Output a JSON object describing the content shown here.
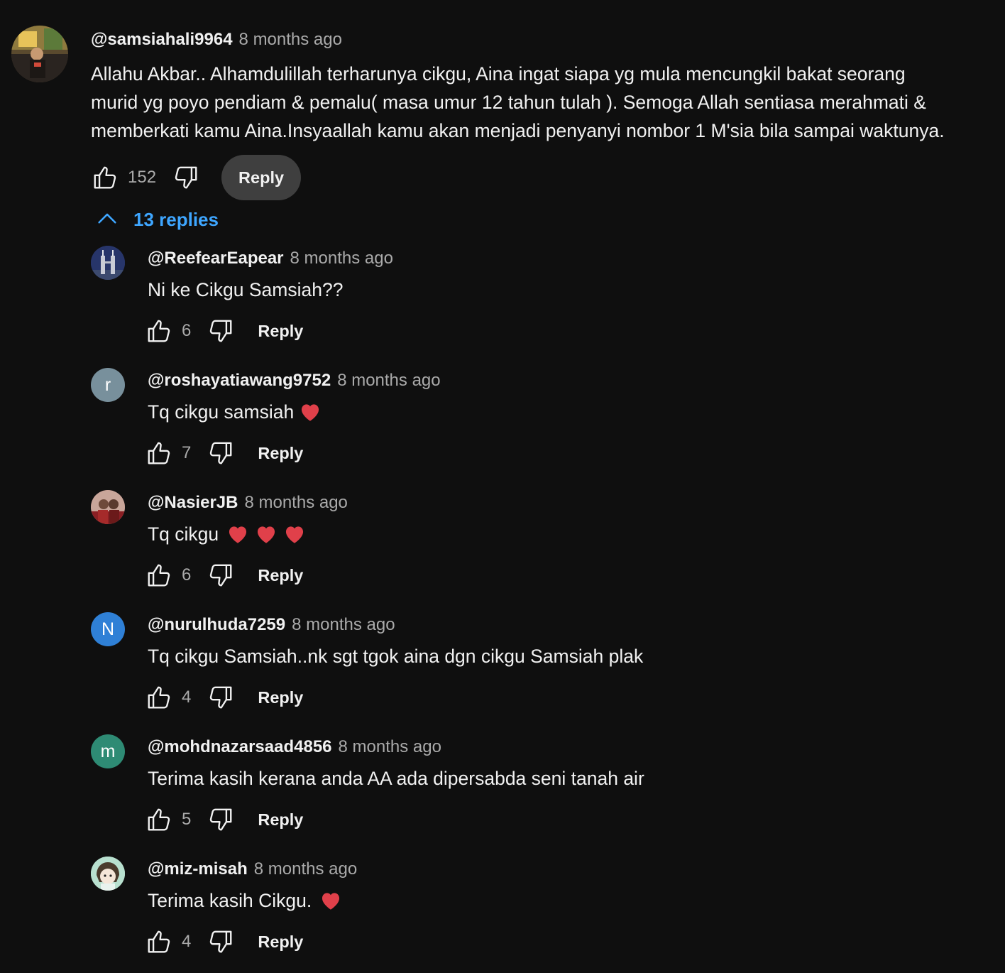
{
  "main_comment": {
    "author": "@samsiahali9964",
    "time": "8 months ago",
    "text_lines": [
      "Allahu Akbar.. Alhamdulillah terharunya cikgu, Aina ingat siapa yg mula mencungkil bakat seorang",
      "murid yg poyo pendiam & pemalu( masa umur 12 tahun tulah ). Semoga Allah sentiasa merahmati &",
      "memberkati kamu Aina.Insyaallah kamu akan menjadi penyanyi nombor 1 M'sia bila sampai waktunya."
    ],
    "likes": "152",
    "reply_label": "Reply"
  },
  "replies_toggle": {
    "label": "13 replies",
    "icon": "chevron-up-icon",
    "color": "#3ea6ff"
  },
  "replies": [
    {
      "author": "@ReefearEapear",
      "time": "8 months ago",
      "text": "Ni ke Cikgu Samsiah??",
      "hearts": 0,
      "likes": "6",
      "reply_label": "Reply",
      "avatar_letter": "",
      "avatar_color": "#2b3a6b"
    },
    {
      "author": "@roshayatiawang9752",
      "time": "8 months ago",
      "text": "Tq cikgu samsiah",
      "hearts": 1,
      "likes": "7",
      "reply_label": "Reply",
      "avatar_letter": "r",
      "avatar_color": "#78909c"
    },
    {
      "author": "@NasierJB",
      "time": "8 months ago",
      "text": "Tq cikgu",
      "hearts": 3,
      "likes": "6",
      "reply_label": "Reply",
      "avatar_letter": "",
      "avatar_color": "#8a3b3b"
    },
    {
      "author": "@nurulhuda7259",
      "time": "8 months ago",
      "text": "Tq cikgu Samsiah..nk sgt tgok aina dgn cikgu Samsiah plak",
      "hearts": 0,
      "likes": "4",
      "reply_label": "Reply",
      "avatar_letter": "N",
      "avatar_color": "#2f80d6"
    },
    {
      "author": "@mohdnazarsaad4856",
      "time": "8 months ago",
      "text": "Terima kasih kerana anda AA ada dipersabda seni tanah air",
      "hearts": 0,
      "likes": "5",
      "reply_label": "Reply",
      "avatar_letter": "m",
      "avatar_color": "#2e8b74"
    },
    {
      "author": "@miz-misah",
      "time": "8 months ago",
      "text": "Terima kasih Cikgu.",
      "hearts": 1,
      "likes": "4",
      "reply_label": "Reply",
      "avatar_letter": "",
      "avatar_color": "#a9d5c2"
    }
  ],
  "icons": {
    "like": "thumbs-up-icon",
    "dislike": "thumbs-down-icon",
    "heart": "red-heart-emoji",
    "heart_color": "#e0404a"
  }
}
